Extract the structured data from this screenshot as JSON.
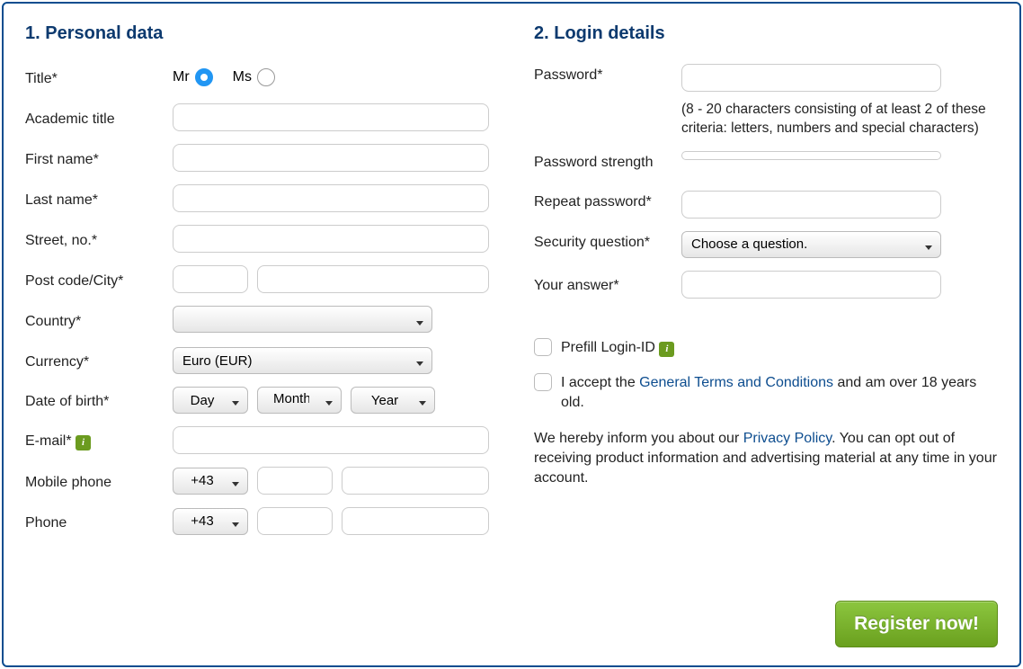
{
  "section1": {
    "heading": "1. Personal data",
    "title_label": "Title*",
    "title_option_mr": "Mr",
    "title_option_ms": "Ms",
    "academic_title_label": "Academic title",
    "first_name_label": "First name*",
    "last_name_label": "Last name*",
    "street_label": "Street, no.*",
    "postcode_city_label": "Post code/City*",
    "country_label": "Country*",
    "country_value": "",
    "currency_label": "Currency*",
    "currency_value": "Euro (EUR)",
    "dob_label": "Date of birth*",
    "dob_day": "Day",
    "dob_month": "Month",
    "dob_year": "Year",
    "email_label": "E-mail*",
    "mobile_label": "Mobile phone",
    "mobile_code": "+43",
    "phone_label": "Phone",
    "phone_code": "+43"
  },
  "section2": {
    "heading": "2. Login details",
    "password_label": "Password*",
    "password_hint": "(8 - 20 characters consisting of at least 2 of these criteria: letters, numbers and special characters)",
    "strength_label": "Password strength",
    "repeat_password_label": "Repeat password*",
    "security_q_label": "Security question*",
    "security_q_value": "Choose a question.",
    "answer_label": "Your answer*",
    "prefill_label": "Prefill Login-ID",
    "terms_prefix": "I accept the ",
    "terms_link": "General Terms and Conditions",
    "terms_suffix": " and am over 18 years old.",
    "privacy_prefix": "We hereby inform you about our ",
    "privacy_link": "Privacy Policy",
    "privacy_suffix": ". You can opt out of receiving product information and advertising material at any time in your account."
  },
  "register_button": "Register now!"
}
